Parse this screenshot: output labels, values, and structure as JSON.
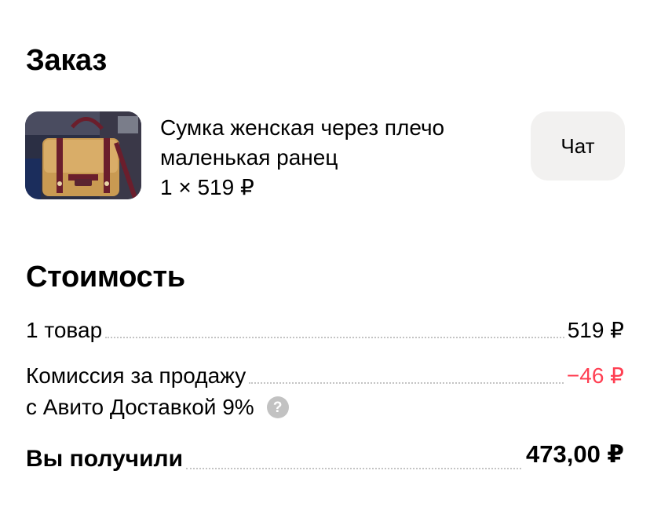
{
  "order": {
    "title": "Заказ",
    "item": {
      "name_line1": "Сумка женская через плечо",
      "name_line2": "маленькая ранец",
      "quantity_price": "1 × 519 ₽"
    },
    "chat_label": "Чат"
  },
  "cost": {
    "title": "Стоимость",
    "goods_label": "1 товар",
    "goods_value": "519 ₽",
    "commission_label": "Комиссия за продажу",
    "commission_label_line2": "с Авито Доставкой 9%",
    "commission_value": "−46 ₽",
    "total_label": "Вы получили",
    "total_value": "473,00 ₽"
  },
  "colors": {
    "negative": "#ff4053",
    "chat_bg": "#f2f1f0",
    "help_icon_bg": "#c2c2c2"
  },
  "icons": {
    "help": "question-circle-icon"
  }
}
